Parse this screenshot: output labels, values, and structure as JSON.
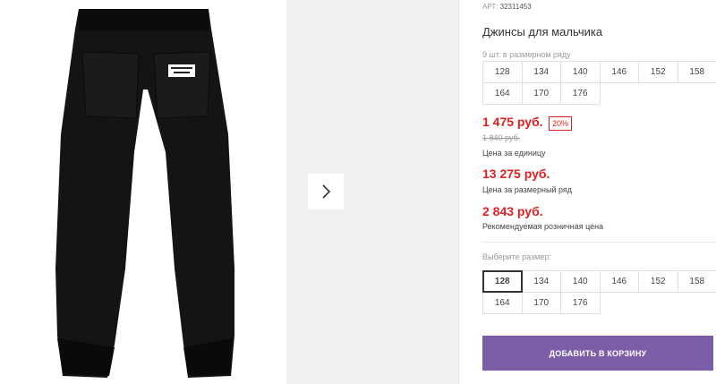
{
  "product": {
    "art_label": "АРТ:",
    "art_number": "32311453",
    "title": "Джинсы для мальчика",
    "pack_note": "9 шт. в размерном ряду"
  },
  "pack_sizes": [
    "128",
    "134",
    "140",
    "146",
    "152",
    "158",
    "164",
    "170",
    "176"
  ],
  "prices": {
    "unit_price": "1 475 руб.",
    "discount": "20%",
    "old_price": "1 840 руб.",
    "unit_label": "Цена за единицу",
    "pack_price": "13 275 руб.",
    "pack_label": "Цена за размерный ряд",
    "retail_price": "2 843 руб.",
    "retail_label": "Рекомендуемая розничная цена"
  },
  "size_select": {
    "label": "Выберите размер:",
    "selected": "128",
    "sizes": [
      "128",
      "134",
      "140",
      "146",
      "152",
      "158",
      "164",
      "170",
      "176"
    ]
  },
  "cart_button": "ДОБАВИТЬ В КОРЗИНУ",
  "colors": {
    "price_red": "#e02020",
    "button_purple": "#7b5ea7"
  },
  "icons": {
    "next": "chevron-right-icon"
  }
}
